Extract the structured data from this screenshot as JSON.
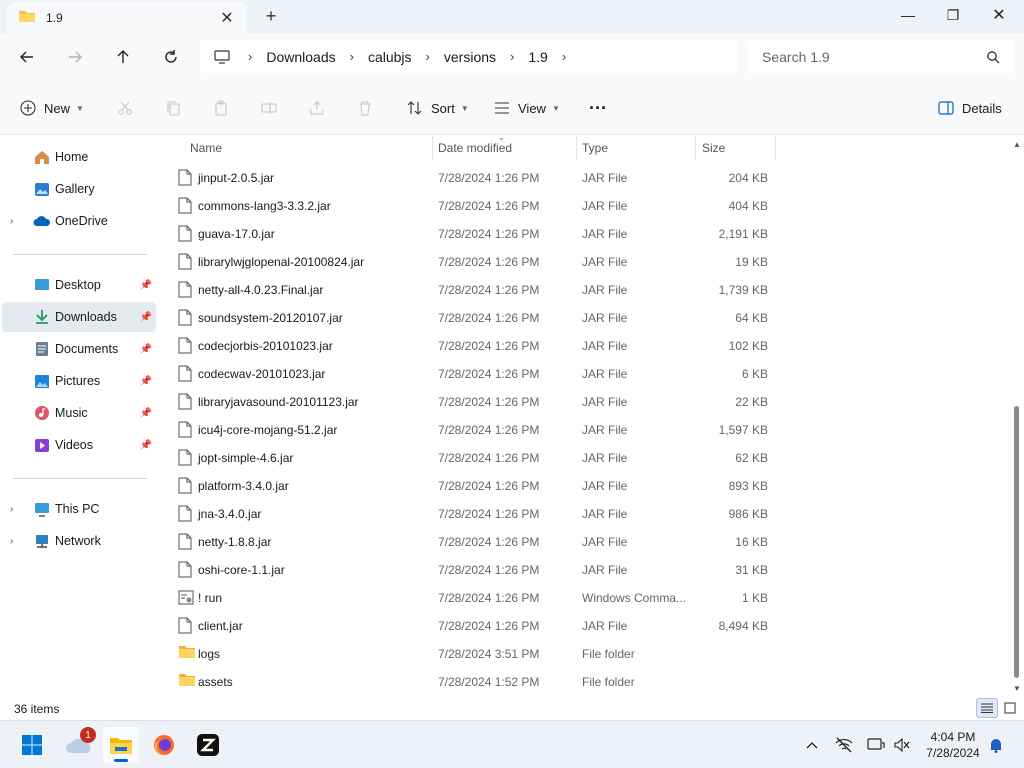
{
  "window": {
    "tab_title": "1.9",
    "close_tab_label": "✕",
    "new_tab_label": "+",
    "minimize_label": "—",
    "maximize_label": "❐",
    "close_label": "✕"
  },
  "address": {
    "crumbs": [
      "Downloads",
      "calubjs",
      "versions",
      "1.9"
    ],
    "search_placeholder": "Search 1.9"
  },
  "toolbar": {
    "new_label": "New",
    "sort_label": "Sort",
    "view_label": "View",
    "more_label": "···",
    "details_label": "Details"
  },
  "sidebar": {
    "items": [
      {
        "label": "Home",
        "icon": "home-icon"
      },
      {
        "label": "Gallery",
        "icon": "gallery-icon"
      },
      {
        "label": "OneDrive",
        "icon": "onedrive-icon"
      },
      {
        "label": "Desktop",
        "icon": "desktop-icon"
      },
      {
        "label": "Downloads",
        "icon": "downloads-icon"
      },
      {
        "label": "Documents",
        "icon": "documents-icon"
      },
      {
        "label": "Pictures",
        "icon": "pictures-icon"
      },
      {
        "label": "Music",
        "icon": "music-icon"
      },
      {
        "label": "Videos",
        "icon": "videos-icon"
      },
      {
        "label": "This PC",
        "icon": "this-pc-icon"
      },
      {
        "label": "Network",
        "icon": "network-icon"
      }
    ]
  },
  "columns": {
    "name": "Name",
    "date": "Date modified",
    "type": "Type",
    "size": "Size"
  },
  "files": [
    {
      "name": "jinput-2.0.5.jar",
      "date": "7/28/2024 1:26 PM",
      "type": "JAR File",
      "size": "204 KB",
      "icon": "file-icon"
    },
    {
      "name": "commons-lang3-3.3.2.jar",
      "date": "7/28/2024 1:26 PM",
      "type": "JAR File",
      "size": "404 KB",
      "icon": "file-icon"
    },
    {
      "name": "guava-17.0.jar",
      "date": "7/28/2024 1:26 PM",
      "type": "JAR File",
      "size": "2,191 KB",
      "icon": "file-icon"
    },
    {
      "name": "librarylwjglopenal-20100824.jar",
      "date": "7/28/2024 1:26 PM",
      "type": "JAR File",
      "size": "19 KB",
      "icon": "file-icon"
    },
    {
      "name": "netty-all-4.0.23.Final.jar",
      "date": "7/28/2024 1:26 PM",
      "type": "JAR File",
      "size": "1,739 KB",
      "icon": "file-icon"
    },
    {
      "name": "soundsystem-20120107.jar",
      "date": "7/28/2024 1:26 PM",
      "type": "JAR File",
      "size": "64 KB",
      "icon": "file-icon"
    },
    {
      "name": "codecjorbis-20101023.jar",
      "date": "7/28/2024 1:26 PM",
      "type": "JAR File",
      "size": "102 KB",
      "icon": "file-icon"
    },
    {
      "name": "codecwav-20101023.jar",
      "date": "7/28/2024 1:26 PM",
      "type": "JAR File",
      "size": "6 KB",
      "icon": "file-icon"
    },
    {
      "name": "libraryjavasound-20101123.jar",
      "date": "7/28/2024 1:26 PM",
      "type": "JAR File",
      "size": "22 KB",
      "icon": "file-icon"
    },
    {
      "name": "icu4j-core-mojang-51.2.jar",
      "date": "7/28/2024 1:26 PM",
      "type": "JAR File",
      "size": "1,597 KB",
      "icon": "file-icon"
    },
    {
      "name": "jopt-simple-4.6.jar",
      "date": "7/28/2024 1:26 PM",
      "type": "JAR File",
      "size": "62 KB",
      "icon": "file-icon"
    },
    {
      "name": "platform-3.4.0.jar",
      "date": "7/28/2024 1:26 PM",
      "type": "JAR File",
      "size": "893 KB",
      "icon": "file-icon"
    },
    {
      "name": "jna-3.4.0.jar",
      "date": "7/28/2024 1:26 PM",
      "type": "JAR File",
      "size": "986 KB",
      "icon": "file-icon"
    },
    {
      "name": "netty-1.8.8.jar",
      "date": "7/28/2024 1:26 PM",
      "type": "JAR File",
      "size": "16 KB",
      "icon": "file-icon"
    },
    {
      "name": "oshi-core-1.1.jar",
      "date": "7/28/2024 1:26 PM",
      "type": "JAR File",
      "size": "31 KB",
      "icon": "file-icon"
    },
    {
      "name": "! run",
      "date": "7/28/2024 1:26 PM",
      "type": "Windows Comma...",
      "size": "1 KB",
      "icon": "batch-file-icon"
    },
    {
      "name": "client.jar",
      "date": "7/28/2024 1:26 PM",
      "type": "JAR File",
      "size": "8,494 KB",
      "icon": "file-icon"
    },
    {
      "name": "logs",
      "date": "7/28/2024 3:51 PM",
      "type": "File folder",
      "size": "",
      "icon": "folder-icon"
    },
    {
      "name": "assets",
      "date": "7/28/2024 1:52 PM",
      "type": "File folder",
      "size": "",
      "icon": "folder-icon"
    }
  ],
  "status": {
    "item_count": "36 items"
  },
  "taskbar": {
    "notification_count": "1",
    "time": "4:04 PM",
    "date": "7/28/2024"
  }
}
